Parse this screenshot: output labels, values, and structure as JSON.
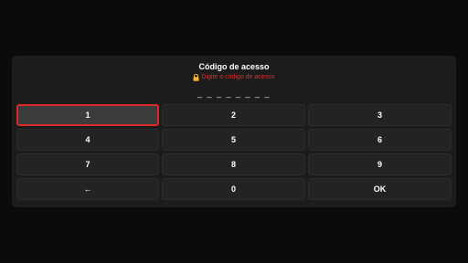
{
  "dialog": {
    "title": "Código de acesso",
    "subtitle": "Digite o código de acesso",
    "lock_icon": "lock-icon",
    "pin_placeholder": "_ _ _ _ _ _ _ _"
  },
  "keypad": {
    "keys": [
      "1",
      "2",
      "3",
      "4",
      "5",
      "6",
      "7",
      "8",
      "9",
      "←",
      "0",
      "OK"
    ],
    "selected_key": "1"
  },
  "colors": {
    "background": "#0c0b0b",
    "dialog": "#1c1c1c",
    "key": "#232323",
    "accent": "#d82a2a",
    "subtitle": "#e12a2a"
  }
}
